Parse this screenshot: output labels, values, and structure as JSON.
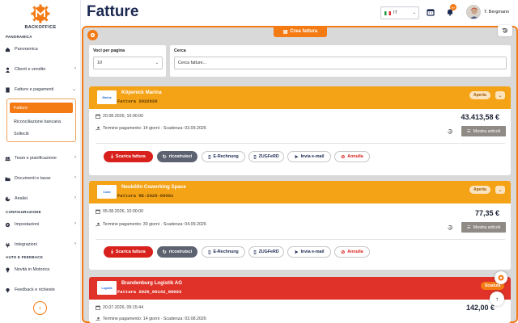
{
  "app": {
    "logo_text": "BACKOFFICE",
    "page_title": "Fatture",
    "accent_color": "#f47a14"
  },
  "sidebar": {
    "section_overview": "PANORAMICA",
    "section_config": "CONFIGURAZIONE",
    "section_feedback": "AUTO E FEEDBACK",
    "items": {
      "overview": "Panoramica",
      "clients": "Clienti e vendite",
      "invoices": "Fatture e pagamenti",
      "team": "Team e pianificazione",
      "docs": "Documenti e tasse",
      "analysis": "Analisi",
      "settings": "Impostazioni",
      "integrations": "Integrazioni",
      "news": "Novità in Motorica",
      "feedback": "Feedback e richieste"
    },
    "submenu": [
      "Fatture",
      "Riconciliazione bancaria",
      "Solleciti"
    ]
  },
  "header": {
    "language": "IT",
    "user_name": "T. Bergmann",
    "notification_count": "9+"
  },
  "toolbar": {
    "create_invoice": "Crea fattura"
  },
  "filters": {
    "per_page_label": "Voci per pagina",
    "per_page_value": "10",
    "search_label": "Cerca",
    "search_placeholder": "Cerca fatture..."
  },
  "invoices": [
    {
      "client": "Köpenick Marina",
      "logo_text": "Marina",
      "number": "Fattura 2022020",
      "status": "Aperta",
      "date": "20.08.2026, 10:00:00",
      "terms": "Termine pagamento: 14 giorni · Scadenza: 03.09.2026",
      "amount": "43.413,58 €",
      "show_items": "Mostra articoli",
      "actions": [
        "Scarica fattura",
        "ricostruisci",
        "E-Rechnung",
        "ZUGFeRD",
        "Invia e-mail",
        "Annulla"
      ]
    },
    {
      "client": "Neukölln Coworking Space",
      "logo_text": "Cowo",
      "number": "Fattura RE-2026-00001",
      "status": "Aperta",
      "date": "05.08.2026, 10:00:00",
      "terms": "Termine pagamento: 30 giorni · Scadenza: 04.09.2026",
      "amount": "77,35 €",
      "show_items": "Mostra articoli",
      "actions": [
        "Scarica fattura",
        "ricostruisci",
        "E-Rechnung",
        "ZUGFeRD",
        "Invia e-mail",
        "Annulla"
      ]
    },
    {
      "client": "Brandenburg Logistik AG",
      "logo_text": "Logistik",
      "number": "Fattura 2026_00142_00003",
      "status": "Scaduta",
      "date": "20.07.2026, 09:15:44",
      "terms": "Termine pagamento: 14 giorni · Scadenza: 03.08.2026",
      "amount": "142,00 €"
    }
  ]
}
